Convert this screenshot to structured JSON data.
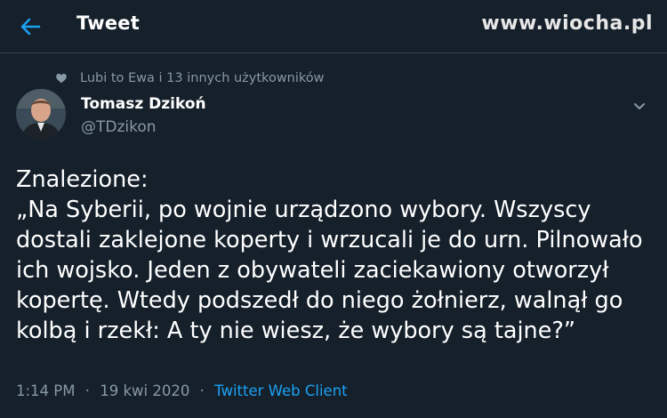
{
  "header": {
    "title": "Tweet",
    "back_icon": "arrow-left-icon"
  },
  "watermark": {
    "text": "www.wiocha.pl"
  },
  "social_context": {
    "icon": "heart-icon",
    "text": "Lubi to Ewa i 13 innych użytkowników"
  },
  "author": {
    "name": "Tomasz Dzikoń",
    "handle": "@TDzikon"
  },
  "tweet": {
    "lines": [
      "Znalezione:",
      "„Na Syberii, po wojnie urządzono wybory. Wszyscy",
      "dostali zaklejone koperty i wrzucali je do urn. Pilnowało",
      "ich wojsko. Jeden z obywateli zaciekawiony otworzył",
      "kopertę. Wtedy podszedł do niego żołnierz, walnął go",
      "kolbą i rzekł: A ty nie wiesz, że wybory są tajne?”"
    ]
  },
  "meta": {
    "time": "1:14 PM",
    "separator": "·",
    "date": "19 kwi 2020",
    "client": "Twitter Web Client"
  },
  "colors": {
    "background": "#15202b",
    "accent": "#1da1f2",
    "secondary_text": "#8899a6",
    "divider": "#38444d"
  }
}
